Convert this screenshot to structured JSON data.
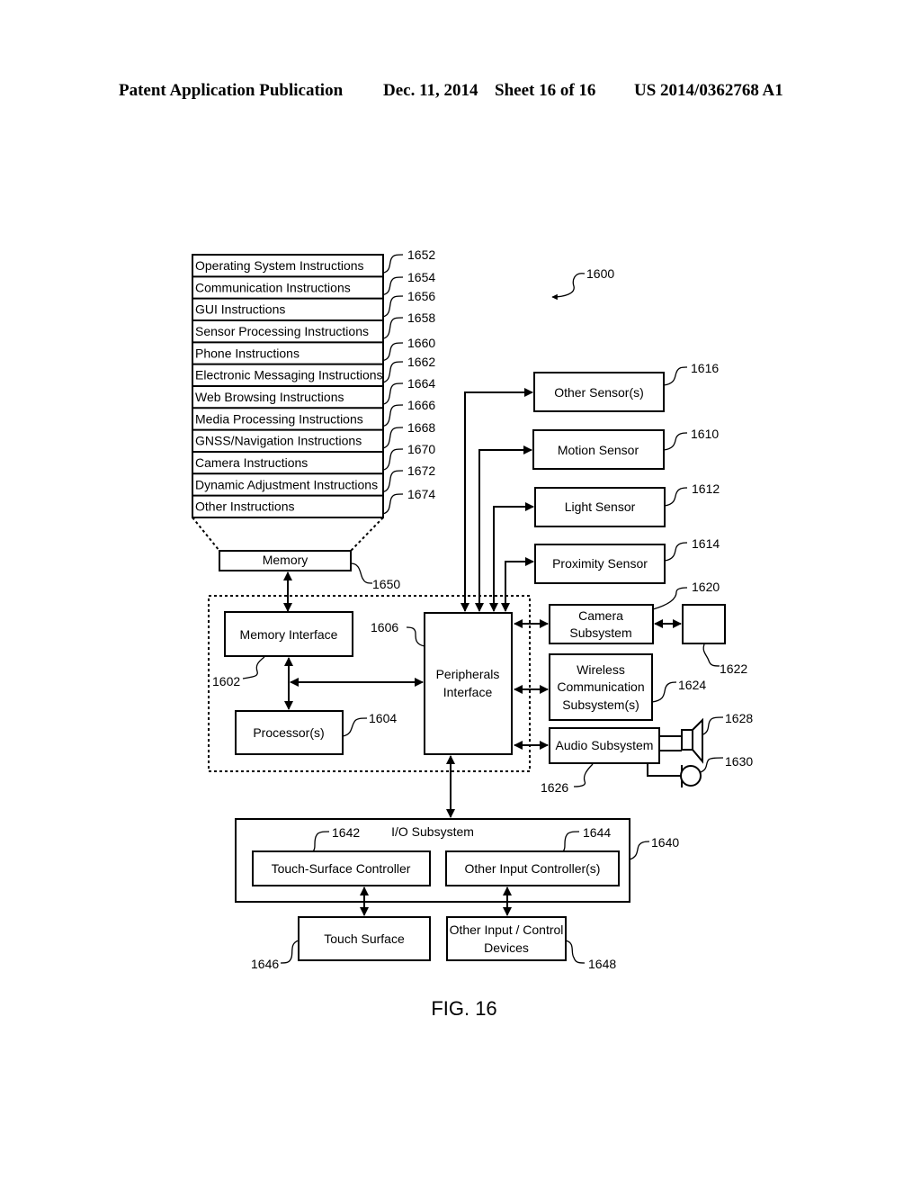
{
  "header": {
    "publication": "Patent Application Publication",
    "date": "Dec. 11, 2014",
    "sheet": "Sheet 16 of 16",
    "number": "US 2014/0362768 A1"
  },
  "figure": {
    "label": "FIG. 16",
    "ref": "1600"
  },
  "memory_stack": {
    "items": [
      {
        "label": "Operating System Instructions",
        "ref": "1652"
      },
      {
        "label": "Communication Instructions",
        "ref": "1654"
      },
      {
        "label": "GUI Instructions",
        "ref": "1656"
      },
      {
        "label": "Sensor Processing Instructions",
        "ref": "1658"
      },
      {
        "label": "Phone Instructions",
        "ref": "1660"
      },
      {
        "label": "Electronic Messaging Instructions",
        "ref": "1662"
      },
      {
        "label": "Web Browsing Instructions",
        "ref": "1664"
      },
      {
        "label": "Media Processing Instructions",
        "ref": "1666"
      },
      {
        "label": "GNSS/Navigation Instructions",
        "ref": "1668"
      },
      {
        "label": "Camera Instructions",
        "ref": "1670"
      },
      {
        "label": "Dynamic Adjustment Instructions",
        "ref": "1672"
      },
      {
        "label": "Other Instructions",
        "ref": "1674"
      }
    ]
  },
  "memory": {
    "label": "Memory",
    "ref": "1650"
  },
  "memory_interface": {
    "label": "Memory Interface",
    "ref": "1602"
  },
  "processor": {
    "label": "Processor(s)",
    "ref": "1604"
  },
  "peripherals": {
    "line1": "Peripherals",
    "line2": "Interface",
    "ref": "1606"
  },
  "sensors": {
    "other": {
      "label": "Other Sensor(s)",
      "ref": "1616"
    },
    "motion": {
      "label": "Motion Sensor",
      "ref": "1610"
    },
    "light": {
      "label": "Light Sensor",
      "ref": "1612"
    },
    "proximity": {
      "label": "Proximity Sensor",
      "ref": "1614"
    }
  },
  "camera": {
    "line1": "Camera",
    "line2": "Subsystem",
    "ref": "1620",
    "sensor_ref": "1622"
  },
  "wireless": {
    "line1": "Wireless",
    "line2": "Communication",
    "line3": "Subsystem(s)",
    "ref": "1624"
  },
  "audio": {
    "label": "Audio Subsystem",
    "ref": "1626",
    "speaker_ref": "1628",
    "mic_ref": "1630"
  },
  "io": {
    "label": "I/O Subsystem",
    "ref": "1640",
    "touch_controller": {
      "label": "Touch-Surface Controller",
      "ref": "1642"
    },
    "other_controller": {
      "label": "Other Input Controller(s)",
      "ref": "1644"
    },
    "touch_surface": {
      "label": "Touch Surface",
      "ref": "1646"
    },
    "other_devices": {
      "line1": "Other Input / Control",
      "line2": "Devices",
      "ref": "1648"
    }
  }
}
